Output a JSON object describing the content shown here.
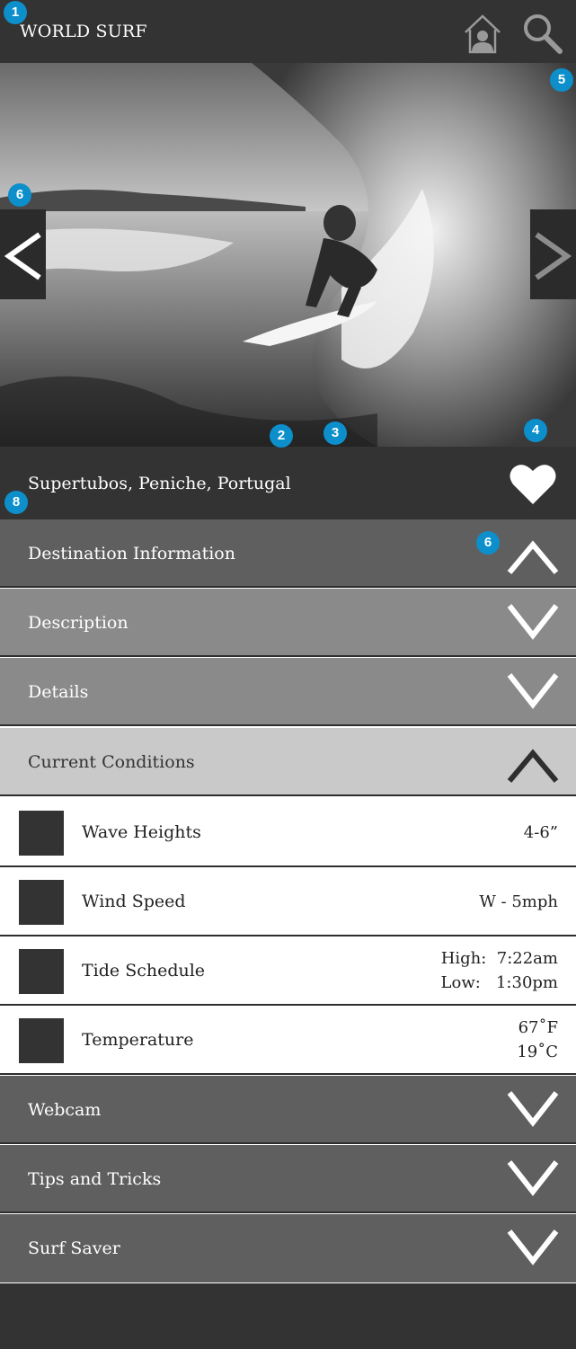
{
  "header": {
    "brand": "WORLD SURF"
  },
  "icons": {
    "home": "home-icon",
    "search": "search-icon",
    "prev": "chevron-left-icon",
    "next": "chevron-right-icon",
    "favorite": "heart-icon"
  },
  "location": {
    "name": "Supertubos, Peniche, Portugal"
  },
  "sections": [
    {
      "label": "Destination Information",
      "state": "expanded",
      "bg": "#5f5f5f",
      "text": "#ffffff",
      "chevron": "#ffffff"
    },
    {
      "label": "Description",
      "state": "collapsed",
      "bg": "#8a8a8a",
      "text": "#ffffff",
      "chevron": "#ffffff"
    },
    {
      "label": "Details",
      "state": "collapsed",
      "bg": "#8a8a8a",
      "text": "#ffffff",
      "chevron": "#ffffff"
    },
    {
      "label": "Current Conditions",
      "state": "expanded",
      "bg": "#c9c9c9",
      "text": "#333333",
      "chevron": "#2e2e2e"
    }
  ],
  "conditions": [
    {
      "label": "Wave Heights",
      "value": [
        "4-6”"
      ]
    },
    {
      "label": "Wind Speed",
      "value": [
        "W - 5mph"
      ]
    },
    {
      "label": "Tide Schedule",
      "value": [
        "High:  7:22am",
        "Low:   1:30pm"
      ]
    },
    {
      "label": "Temperature",
      "value": [
        "67˚F",
        "19˚C"
      ]
    }
  ],
  "more_sections": [
    {
      "label": "Webcam",
      "state": "collapsed"
    },
    {
      "label": "Tips and Tricks",
      "state": "collapsed"
    },
    {
      "label": "Surf Saver",
      "state": "collapsed"
    }
  ],
  "annotations": [
    "1",
    "5",
    "6",
    "2",
    "3",
    "4",
    "8",
    "6"
  ],
  "colors": {
    "bar": "#333333",
    "section_dark": "#5f5f5f",
    "section_mid": "#8a8a8a",
    "section_light": "#c9c9c9",
    "badge": "#0d8fcb"
  }
}
